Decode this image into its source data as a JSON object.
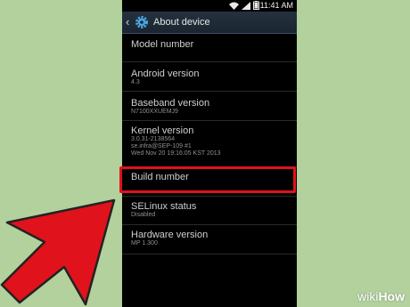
{
  "statusbar": {
    "time": "11:41 AM"
  },
  "actionbar": {
    "back_icon": "chevron-left",
    "settings_icon": "gear-icon",
    "title": "About device"
  },
  "items": [
    {
      "label": "Model number",
      "sub": ""
    },
    {
      "label": "Android version",
      "sub": "4.3"
    },
    {
      "label": "Baseband version",
      "sub": "N7100XXUEMJ9"
    },
    {
      "label": "Kernel version",
      "sub": "3.0.31-2138564",
      "sub2": "se.infra@SEP-109 #1",
      "sub3": "Wed Nov 20 19:16:05 KST 2013"
    },
    {
      "label": "Build number",
      "sub": ""
    },
    {
      "label": "SELinux status",
      "sub": "Disabled"
    },
    {
      "label": "Hardware version",
      "sub": "MP 1.300"
    }
  ],
  "watermark": {
    "prefix": "wiki",
    "suffix": "How"
  },
  "colors": {
    "highlight": "#e0121b",
    "background": "#b2d19d",
    "actionbar": "#24323e"
  }
}
